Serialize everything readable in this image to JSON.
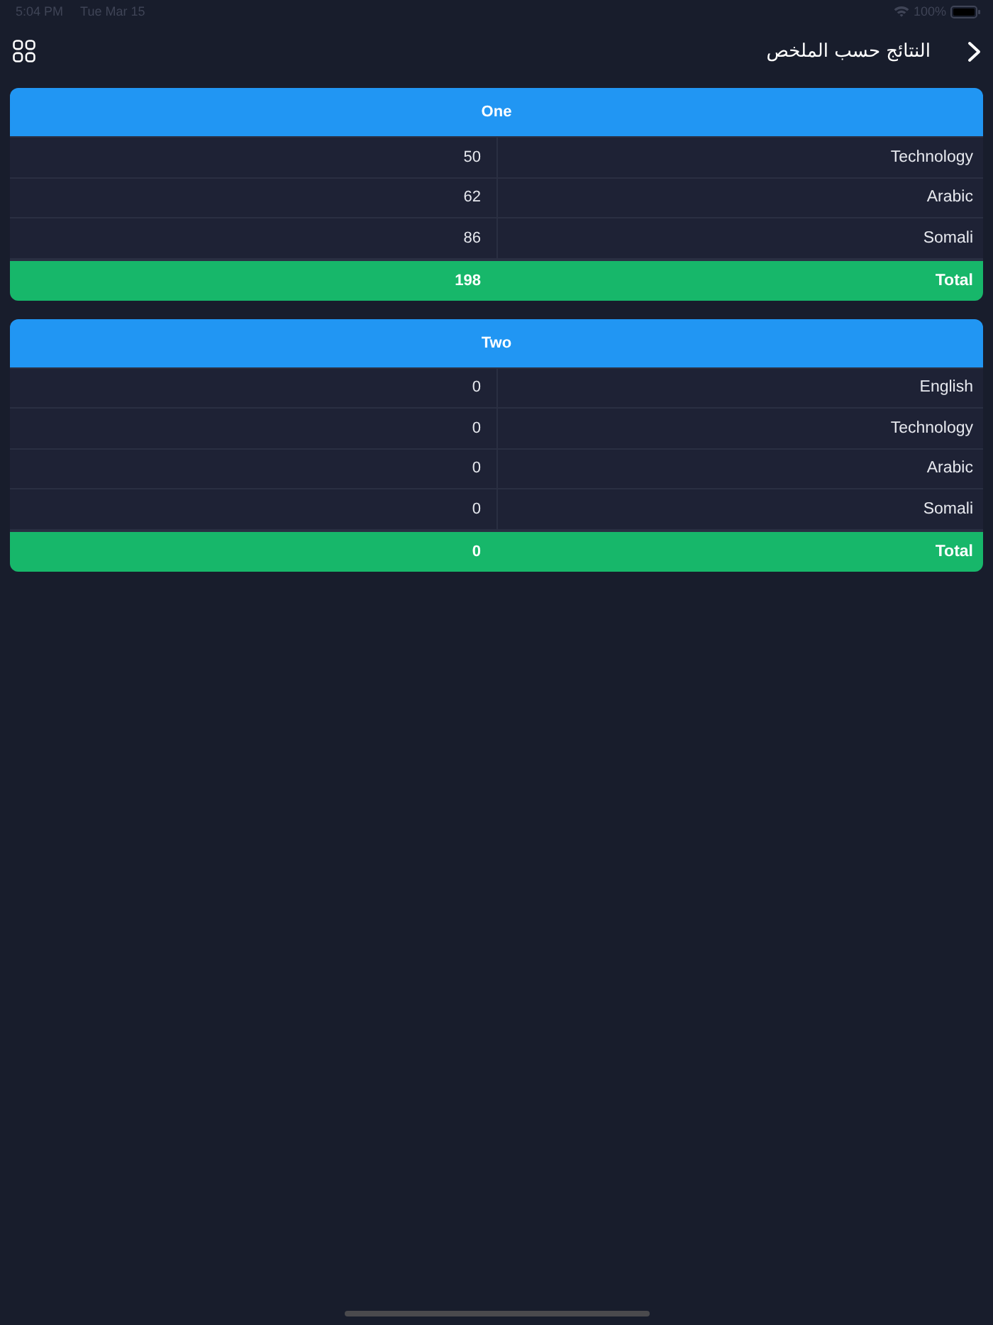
{
  "status_bar": {
    "time": "5:04 PM",
    "date": "Tue Mar 15",
    "battery": "100%"
  },
  "nav_bar": {
    "title": "النتائج حسب الملخص"
  },
  "sections": [
    {
      "title": "One",
      "rows": [
        {
          "label": "Technology",
          "value": "50"
        },
        {
          "label": "Arabic",
          "value": "62"
        },
        {
          "label": "Somali",
          "value": "86"
        }
      ],
      "total": {
        "label": "Total",
        "value": "198"
      }
    },
    {
      "title": "Two",
      "rows": [
        {
          "label": "English",
          "value": "0"
        },
        {
          "label": "Technology",
          "value": "0"
        },
        {
          "label": "Arabic",
          "value": "0"
        },
        {
          "label": "Somali",
          "value": "0"
        }
      ],
      "total": {
        "label": "Total",
        "value": "0"
      }
    }
  ]
}
